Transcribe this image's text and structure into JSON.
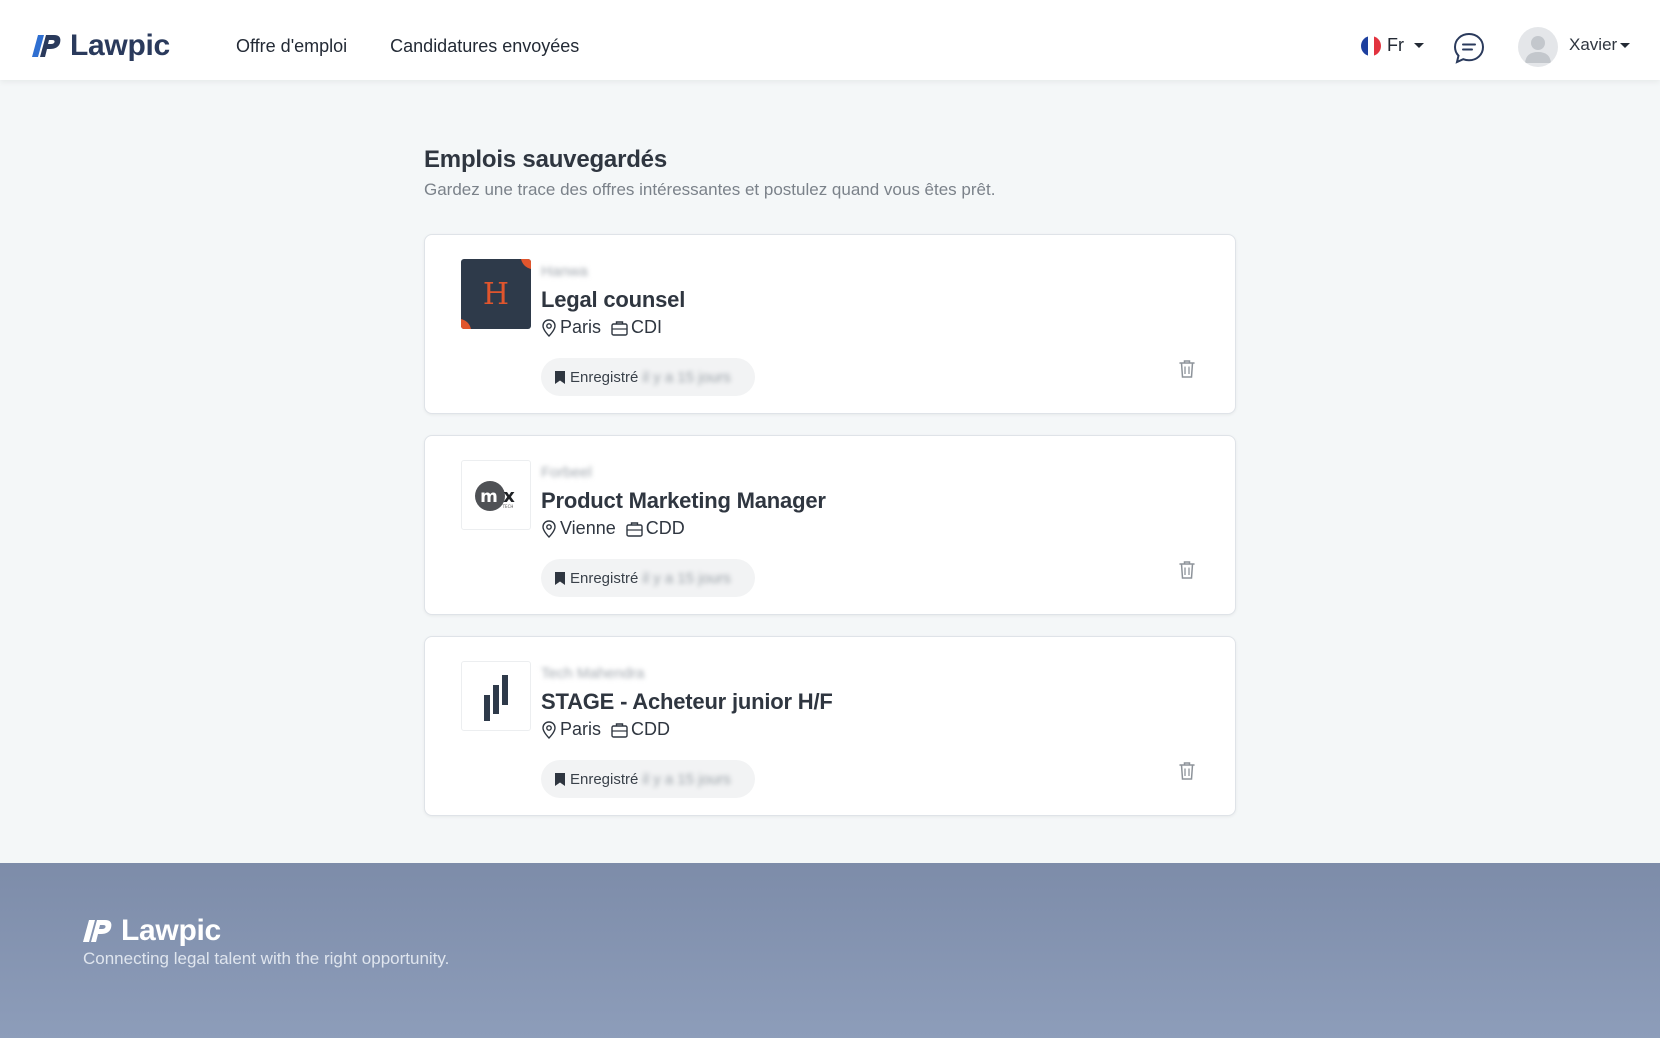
{
  "header": {
    "brand": "Lawpic",
    "nav": [
      {
        "label": "Offre d'emploi"
      },
      {
        "label": "Candidatures envoyées"
      }
    ],
    "language": "Fr",
    "user_name": "Xavier"
  },
  "page": {
    "title": "Emplois sauvegardés",
    "subtitle": "Gardez une trace des offres intéressantes et postulez quand vous êtes prêt."
  },
  "jobs": [
    {
      "company": "Hanwa",
      "title": "Legal counsel",
      "location": "Paris",
      "contract": "CDI",
      "saved_label": "Enregistré",
      "saved_ago": "il y a 15 jours",
      "logo_letter": "H",
      "logo_bg": "#2e3a4a",
      "logo_accent": "#e0552d"
    },
    {
      "company": "Forbeel",
      "title": "Product Marketing Manager",
      "location": "Vienne",
      "contract": "CDD",
      "saved_label": "Enregistré",
      "saved_ago": "il y a 15 jours",
      "logo_letter": "mx",
      "logo_sub": "TECH"
    },
    {
      "company": "Tech Mahendra",
      "title": "STAGE - Acheteur junior H/F",
      "location": "Paris",
      "contract": "CDD",
      "saved_label": "Enregistré",
      "saved_ago": "il y a 15 jours"
    }
  ],
  "footer": {
    "brand": "Lawpic",
    "tagline": "Connecting legal talent with the right opportunity."
  },
  "colors": {
    "brand_dark": "#2a3a5c",
    "brand_blue": "#2f6fd1",
    "footer_bg": "#7d8ca9",
    "page_bg": "#f4f7f8"
  },
  "icons": [
    "logo-mark-icon",
    "flag-fr-icon",
    "chat-icon",
    "user-avatar-icon",
    "location-pin-icon",
    "briefcase-icon",
    "bookmark-icon",
    "trash-icon"
  ]
}
